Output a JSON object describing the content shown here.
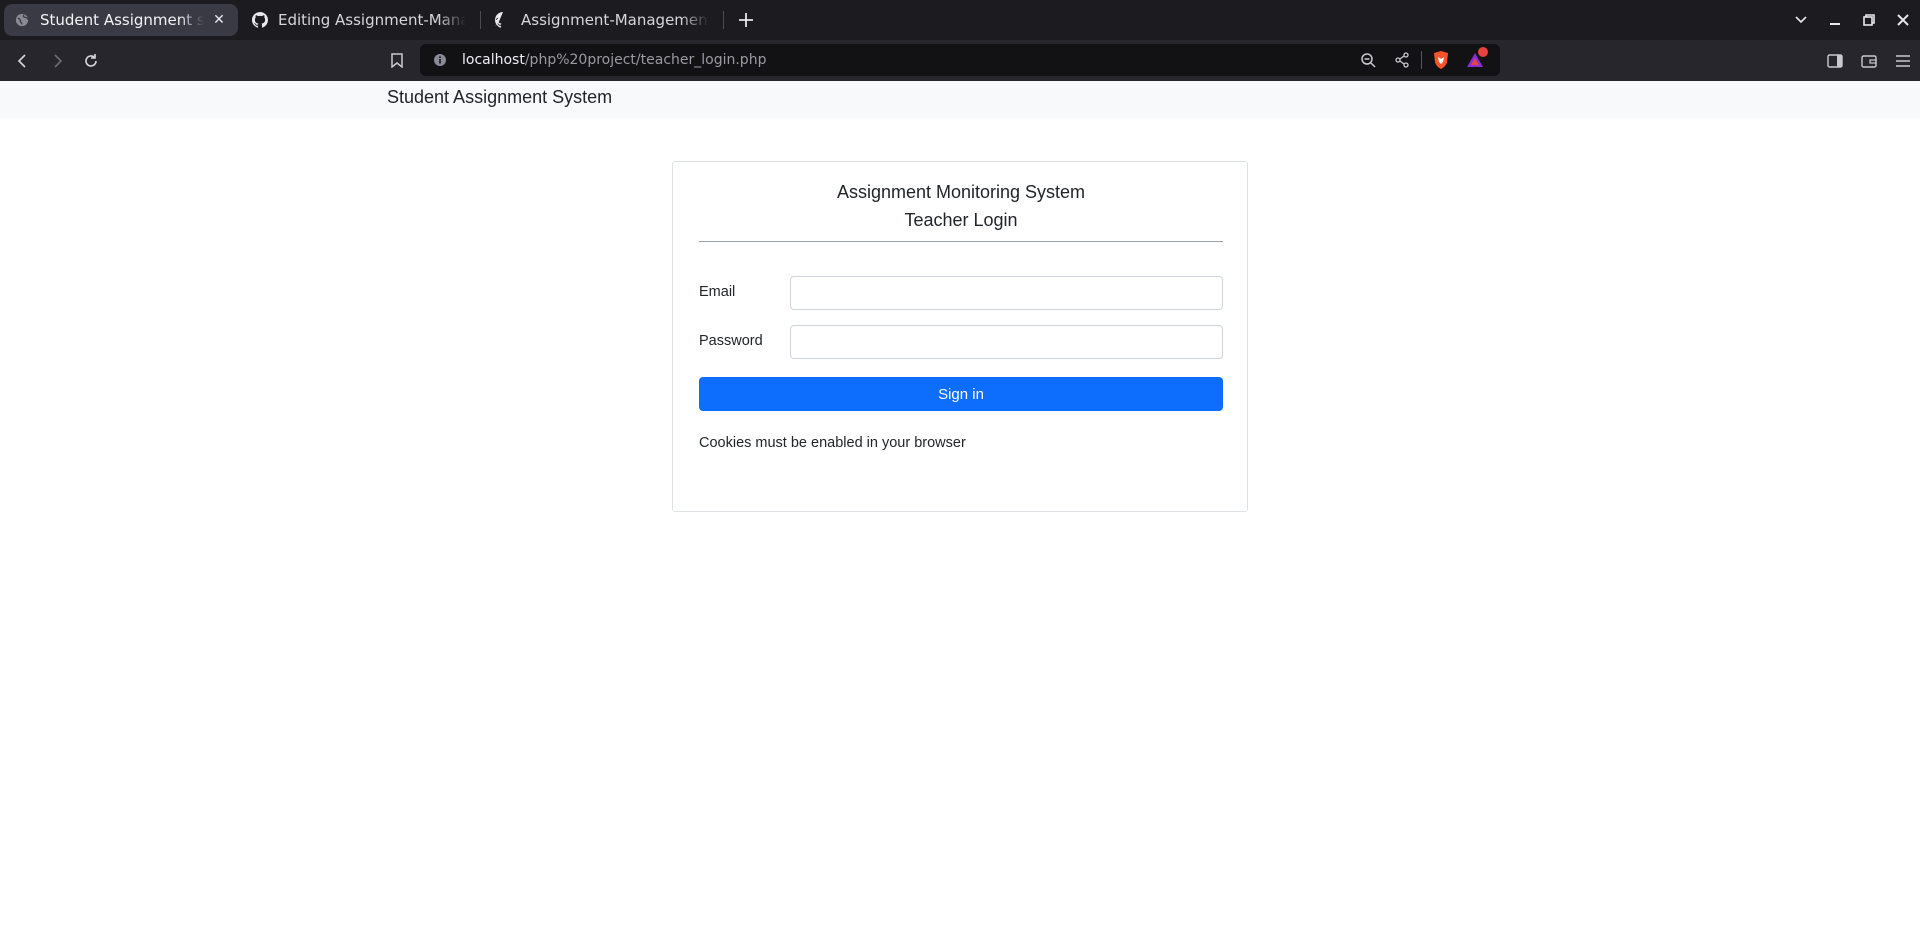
{
  "browser": {
    "tabs": [
      {
        "title": "Student Assignment syste",
        "active": true,
        "icon": "globe-icon"
      },
      {
        "title": "Editing Assignment-Manager",
        "active": false,
        "icon": "github-icon"
      },
      {
        "title": "Assignment-Management-Sy",
        "active": false,
        "icon": "github-icon"
      }
    ],
    "url": {
      "host": "localhost",
      "path": "/php%20project/teacher_login.php"
    },
    "shield_badge_color": "#f84f1e",
    "brave_color": "#fb542b",
    "notification_color": "#e8433f"
  },
  "navbar": {
    "brand": "Student Assignment System"
  },
  "login": {
    "title_line1": "Assignment Monitoring System",
    "title_line2": "Teacher Login",
    "email_label": "Email",
    "email_value": "",
    "password_label": "Password",
    "password_value": "",
    "submit_label": "Sign in",
    "note": "Cookies must be enabled in your browser"
  },
  "colors": {
    "primary": "#0d6efd",
    "navbar_bg": "#f8f9fa",
    "chrome_bg": "#1b1b20"
  }
}
